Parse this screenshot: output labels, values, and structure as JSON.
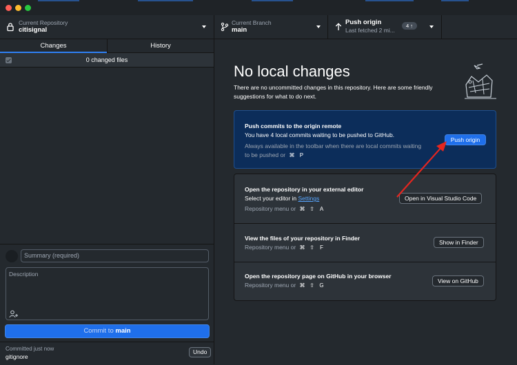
{
  "toolbar": {
    "repo": {
      "label": "Current Repository",
      "value": "citisignal"
    },
    "branch": {
      "label": "Current Branch",
      "value": "main"
    },
    "push": {
      "label": "Push origin",
      "sub": "Last fetched 2 mi...",
      "badge": "4 ↑"
    }
  },
  "tabs": [
    {
      "label": "Changes",
      "active": true
    },
    {
      "label": "History",
      "active": false
    }
  ],
  "changes": {
    "count_text": "0 changed files"
  },
  "commit": {
    "summary_placeholder": "Summary (required)",
    "description_placeholder": "Description",
    "button_prefix": "Commit to ",
    "button_branch": "main"
  },
  "last_commit": {
    "label": "Committed just now",
    "message": "gitignore",
    "undo_label": "Undo"
  },
  "main": {
    "title": "No local changes",
    "subtitle": "There are no uncommitted changes in this repository. Here are some friendly suggestions for what to do next.",
    "push_card": {
      "heading": "Push commits to the origin remote",
      "desc": "You have 4 local commits waiting to be pushed to GitHub.",
      "meta": "Always available in the toolbar when there are local commits waiting to be pushed or",
      "keys": [
        "⌘",
        "P"
      ],
      "button": "Push origin"
    },
    "editor_card": {
      "heading": "Open the repository in your external editor",
      "desc_prefix": "Select your editor in ",
      "desc_link": "Settings",
      "meta": "Repository menu or",
      "keys": [
        "⌘",
        "⇧",
        "A"
      ],
      "button": "Open in Visual Studio Code"
    },
    "finder_card": {
      "heading": "View the files of your repository in Finder",
      "meta": "Repository menu or",
      "keys": [
        "⌘",
        "⇧",
        "F"
      ],
      "button": "Show in Finder"
    },
    "github_card": {
      "heading": "Open the repository page on GitHub in your browser",
      "meta": "Repository menu or",
      "keys": [
        "⌘",
        "⇧",
        "G"
      ],
      "button": "View on GitHub"
    }
  },
  "colors": {
    "accent": "#1f6feb",
    "annotation_arrow": "#e5261f",
    "background": "#24292e"
  }
}
